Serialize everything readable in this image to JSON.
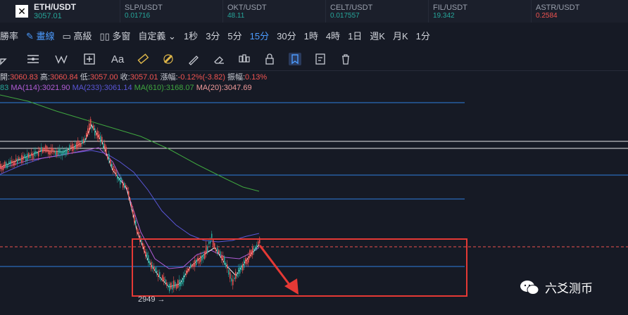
{
  "ticker": {
    "main": {
      "symbol": "ETH/USDT",
      "price": "3057.01"
    },
    "items": [
      {
        "symbol": "SLP/USDT",
        "price": "0.01716",
        "color": "#26a69a"
      },
      {
        "symbol": "OKT/USDT",
        "price": "48.11",
        "color": "#26a69a"
      },
      {
        "symbol": "CELT/USDT",
        "price": "0.017557",
        "color": "#26a69a"
      },
      {
        "symbol": "FIL/USDT",
        "price": "19.342",
        "color": "#26a69a"
      },
      {
        "symbol": "ASTR/USDT",
        "price": "0.2584",
        "color": "#ef5350"
      }
    ]
  },
  "toolbar": {
    "items": [
      "勝率",
      "畫線",
      "高級",
      "多窗",
      "自定義",
      "1秒",
      "3分",
      "5分",
      "15分",
      "30分",
      "1時",
      "4時",
      "1日",
      "週K",
      "月K",
      "1分"
    ],
    "active": "15分"
  },
  "ohlc": {
    "open_label": "開:",
    "open": "3060.83",
    "high_label": "高:",
    "high": "3060.84",
    "low_label": "低:",
    "low": "3057.00",
    "close_label": "收:",
    "close": "3057.01",
    "change_label": "漲幅:",
    "change": "-0.12%(-3.82)",
    "amp_label": "振幅:",
    "amp": "0.13%"
  },
  "ma": {
    "first": "83",
    "ma114": "MA(114):3021.90",
    "ma233": "MA(233):3061.14",
    "ma610": "MA(610):3168.07",
    "ma20": "MA(20):3047.69"
  },
  "colors": {
    "up": "#26a69a",
    "down": "#ef5350",
    "ma114": "#b05cd6",
    "ma233": "#5a56d6",
    "ma610": "#3fa63f",
    "ma20": "#e8e8e8",
    "level": "#2f7fe0",
    "box": "#e53935"
  },
  "low_marker": "2949 →",
  "watermark": "六爻测币"
}
